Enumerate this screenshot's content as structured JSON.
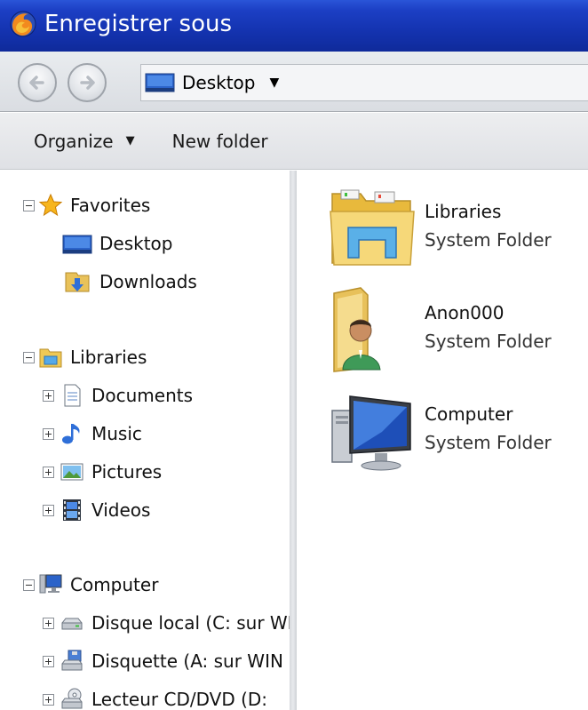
{
  "window": {
    "title": "Enregistrer sous"
  },
  "address": {
    "location": "Desktop"
  },
  "toolbar": {
    "organize_label": "Organize",
    "new_folder_label": "New folder"
  },
  "nav": {
    "favorites": {
      "label": "Favorites",
      "items": [
        {
          "label": "Desktop",
          "icon": "desktop-icon"
        },
        {
          "label": "Downloads",
          "icon": "downloads-icon"
        }
      ]
    },
    "libraries": {
      "label": "Libraries",
      "items": [
        {
          "label": "Documents",
          "icon": "documents-icon"
        },
        {
          "label": "Music",
          "icon": "music-icon"
        },
        {
          "label": "Pictures",
          "icon": "pictures-icon"
        },
        {
          "label": "Videos",
          "icon": "videos-icon"
        }
      ]
    },
    "computer": {
      "label": "Computer",
      "items": [
        {
          "label": "Disque local (C: sur WI",
          "icon": "hard-drive-icon"
        },
        {
          "label": "Disquette (A: sur WIN",
          "icon": "floppy-drive-icon"
        },
        {
          "label": "Lecteur CD/DVD (D:",
          "icon": "cd-drive-icon"
        }
      ]
    }
  },
  "content": {
    "items": [
      {
        "name": "Libraries",
        "type": "System Folder",
        "icon": "libraries-folder-icon"
      },
      {
        "name": "Anon000",
        "type": "System Folder",
        "icon": "user-folder-icon"
      },
      {
        "name": "Computer",
        "type": "System Folder",
        "icon": "computer-icon"
      }
    ]
  },
  "colors": {
    "titlebar": "#1433b0",
    "folder_yellow": "#f2c94c",
    "background": "#ffffff"
  }
}
